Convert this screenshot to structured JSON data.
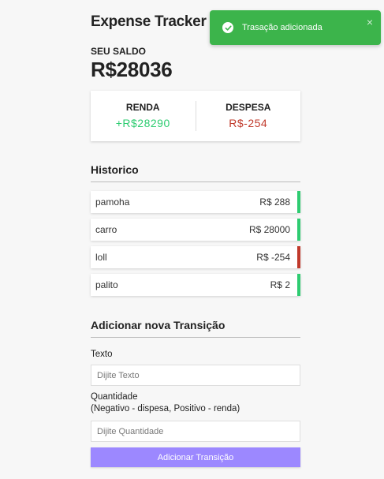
{
  "app": {
    "title": "Expense Tracker"
  },
  "balance": {
    "label": "SEU SALDO",
    "value": "R$28036"
  },
  "summary": {
    "income_label": "RENDA",
    "income_value": "+R$28290",
    "expense_label": "DESPESA",
    "expense_value": "R$-254",
    "income_color": "#2ecc71",
    "expense_color": "#c0392b"
  },
  "history": {
    "title": "Historico",
    "items": [
      {
        "text": "pamoha",
        "amount": "R$ 288",
        "type": "plus"
      },
      {
        "text": "carro",
        "amount": "R$ 28000",
        "type": "plus"
      },
      {
        "text": "loll",
        "amount": "R$ -254",
        "type": "minus"
      },
      {
        "text": "palito",
        "amount": "R$ 2",
        "type": "plus"
      }
    ]
  },
  "form": {
    "title": "Adicionar nova Transição",
    "text_label": "Texto",
    "text_placeholder": "Dijite Texto",
    "text_value": "",
    "amount_label": "Quantidade",
    "amount_hint": "(Negativo - dispesa, Positivo - renda)",
    "amount_placeholder": "Dijite Quantidade",
    "amount_value": "",
    "submit_label": "Adicionar Transição",
    "accent_color": "#9c88ff"
  },
  "toast": {
    "message": "Trasação adicionada",
    "icon": "check-circle-icon",
    "close_icon": "close-icon",
    "close_glyph": "×",
    "color": "#3cb44b"
  }
}
